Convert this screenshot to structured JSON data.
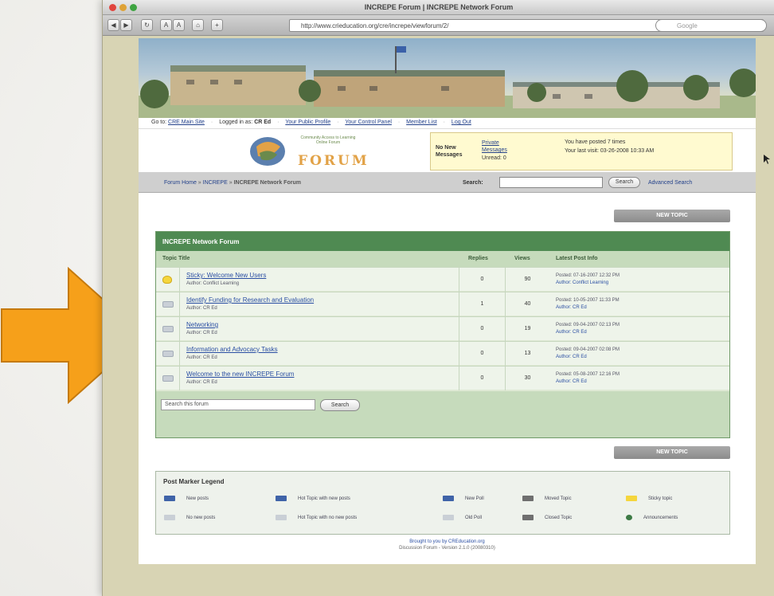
{
  "window": {
    "title": "INCREPE Forum | INCREPE Network Forum",
    "url": "http://www.crieducation.org/cre/increpe/viewforum/2/",
    "search_placeholder": "Google"
  },
  "site": {
    "topnav": {
      "goto_prefix": "Go to:",
      "main_site": "CRE Main Site",
      "logged_in_prefix": "Logged in as:",
      "user": "CR Ed",
      "links": [
        "Your Public Profile",
        "Your Control Panel",
        "Member List",
        "Log Out"
      ]
    },
    "logo_word": "FORUM",
    "logo_sub": "Community Access to Learning Online Forum",
    "messages": {
      "label": "No New Messages",
      "pm_link": "Private Messages",
      "unread": "Unread: 0",
      "posted": "You have posted 7 times",
      "last_visit": "Your last visit: 03-26-2008 10:33 AM"
    }
  },
  "bar": {
    "crumbs": [
      "Forum Home",
      "INCREPE"
    ],
    "current": "INCREPE Network Forum",
    "search_label": "Search:",
    "search_button": "Search",
    "advanced": "Advanced Search"
  },
  "new_topic": "NEW TOPIC",
  "forum": {
    "name": "INCREPE Network Forum",
    "columns": {
      "title": "Topic Title",
      "replies": "Replies",
      "views": "Views",
      "latest": "Latest Post Info"
    },
    "topics": [
      {
        "title": "Sticky: Welcome New Users",
        "author": "Author: Conflict Learning",
        "replies": "0",
        "views": "90",
        "posted": "Posted: 07-16-2007 12:32 PM",
        "latest_author": "Author: Conflict Learning",
        "sticky": true
      },
      {
        "title": "Identify Funding for Research and Evaluation",
        "author": "Author: CR Ed",
        "replies": "1",
        "views": "40",
        "posted": "Posted: 10-05-2007 11:33 PM",
        "latest_author": "Author: CR Ed",
        "sticky": false
      },
      {
        "title": "Networking",
        "author": "Author: CR Ed",
        "replies": "0",
        "views": "19",
        "posted": "Posted: 09-04-2007 02:13 PM",
        "latest_author": "Author: CR Ed",
        "sticky": false
      },
      {
        "title": "Information and Advocacy Tasks",
        "author": "Author: CR Ed",
        "replies": "0",
        "views": "13",
        "posted": "Posted: 09-04-2007 02:08 PM",
        "latest_author": "Author: CR Ed",
        "sticky": false
      },
      {
        "title": "Welcome to the new INCREPE Forum",
        "author": "Author: CR Ed",
        "replies": "0",
        "views": "30",
        "posted": "Posted: 05-08-2007 12:16 PM",
        "latest_author": "Author: CR Ed",
        "sticky": false
      }
    ],
    "search_placeholder": "Search this forum",
    "search_button": "Search"
  },
  "legend": {
    "title": "Post Marker Legend",
    "items": [
      {
        "label": "New posts",
        "color": "#3f63a8"
      },
      {
        "label": "Hot Topic with new posts",
        "color": "#3f63a8"
      },
      {
        "label": "New Poll",
        "color": "#3f63a8"
      },
      {
        "label": "Moved Topic",
        "color": "#6f6f6f"
      },
      {
        "label": "Sticky topic",
        "color": "#f5d63d"
      },
      {
        "label": "No new posts",
        "color": "#c9cfd6"
      },
      {
        "label": "Hot Topic with no new posts",
        "color": "#c9cfd6"
      },
      {
        "label": "Old Poll",
        "color": "#c9cfd6"
      },
      {
        "label": "Closed Topic",
        "color": "#6f6f6f"
      },
      {
        "label": "Announcements",
        "color": "#3c7a44"
      }
    ]
  },
  "footer": {
    "line1": "Brought to you by CREducation.org",
    "line2": "Discussion Forum - Version 2.1.0 (20080310)"
  },
  "colors": {
    "arrow": "#f6a01a",
    "forum_header": "#4f8a52",
    "link": "#2a4ea3"
  }
}
